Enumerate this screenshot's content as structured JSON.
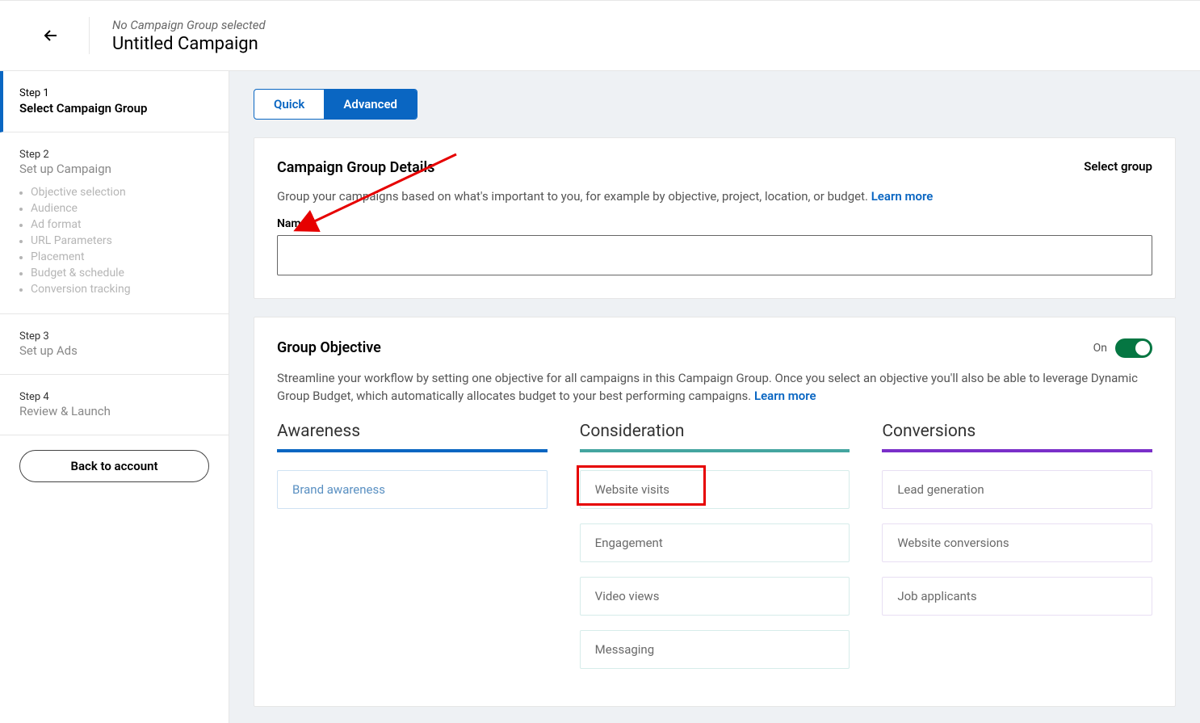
{
  "header": {
    "breadcrumb": "No Campaign Group selected",
    "title": "Untitled Campaign"
  },
  "sidebar": {
    "steps": [
      {
        "num": "Step 1",
        "title": "Select Campaign Group"
      },
      {
        "num": "Step 2",
        "title": "Set up Campaign"
      },
      {
        "num": "Step 3",
        "title": "Set up Ads"
      },
      {
        "num": "Step 4",
        "title": "Review & Launch"
      }
    ],
    "sub_items": [
      "Objective selection",
      "Audience",
      "Ad format",
      "URL Parameters",
      "Placement",
      "Budget & schedule",
      "Conversion tracking"
    ],
    "back_btn": "Back to account"
  },
  "tabs": {
    "quick": "Quick",
    "advanced": "Advanced"
  },
  "details_card": {
    "heading": "Campaign Group Details",
    "select_group": "Select group",
    "desc": "Group your campaigns based on what's important to you, for example by objective, project, location, or budget. ",
    "learn_more": "Learn more",
    "name_label": "Name",
    "name_value": ""
  },
  "objective_card": {
    "heading": "Group Objective",
    "toggle_label": "On",
    "desc": "Streamline your workflow by setting one objective for all campaigns in this Campaign Group. Once you select an objective you'll also be able to leverage Dynamic Group Budget, which automatically allocates budget to your best performing campaigns. ",
    "learn_more": "Learn more",
    "columns": {
      "awareness": {
        "title": "Awareness",
        "items": [
          "Brand awareness"
        ]
      },
      "consideration": {
        "title": "Consideration",
        "items": [
          "Website visits",
          "Engagement",
          "Video views",
          "Messaging"
        ]
      },
      "conversions": {
        "title": "Conversions",
        "items": [
          "Lead generation",
          "Website conversions",
          "Job applicants"
        ]
      }
    }
  }
}
